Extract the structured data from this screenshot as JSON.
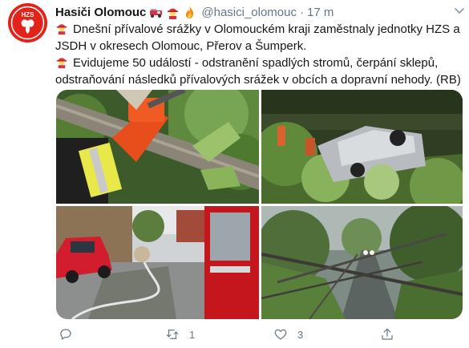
{
  "tweet": {
    "display_name": "Hasiči Olomouc",
    "handle": "@hasici_olomouc",
    "separator": "·",
    "time": "17 m",
    "avatar_text": "HZS",
    "name_emojis": [
      "fire-engine-icon",
      "firefighter-icon",
      "fire-icon"
    ],
    "lines": [
      "Dnešní přívalové srážky v Olomouckém kraji zaměstnaly jednotky HZS a JSDH v okresech Olomouc, Přerov a Šumperk.",
      "Evidujeme 50 událostí - odstranění spadlých stromů, čerpání sklepů, odstraňování následků přívalových srážek v obcích a dopravní nehody. (RB)"
    ],
    "line_emojis": [
      "firefighter-icon",
      "firefighter-icon"
    ],
    "photos": [
      "chainsaw-cutting-fallen-tree",
      "overturned-car-in-ditch",
      "red-car-and-fire-hose",
      "fallen-tree-over-road"
    ]
  },
  "actions": {
    "reply_count": "",
    "retweet_count": "1",
    "like_count": "3",
    "share_count": ""
  },
  "colors": {
    "brand_red": "#e2231a",
    "text": "#14171a",
    "muted": "#657786"
  }
}
